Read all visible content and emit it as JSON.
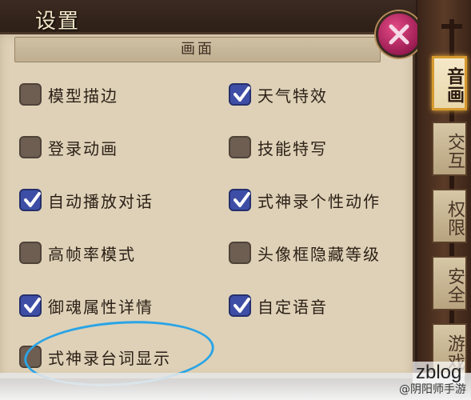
{
  "title": "设置",
  "close_icon": "close-x-icon",
  "section": {
    "header": "画面"
  },
  "options": [
    {
      "label": "模型描边",
      "checked": false
    },
    {
      "label": "天气特效",
      "checked": true
    },
    {
      "label": "登录动画",
      "checked": false
    },
    {
      "label": "技能特写",
      "checked": false
    },
    {
      "label": "自动播放对话",
      "checked": true
    },
    {
      "label": "式神录个性动作",
      "checked": true
    },
    {
      "label": "高帧率模式",
      "checked": false
    },
    {
      "label": "头像框隐藏等级",
      "checked": false
    },
    {
      "label": "御魂属性详情",
      "checked": true
    },
    {
      "label": "自定语音",
      "checked": true
    },
    {
      "label": "式神录台词显示",
      "checked": false
    }
  ],
  "tabs": [
    {
      "label": "音画",
      "active": true
    },
    {
      "label": "交互",
      "active": false
    },
    {
      "label": "权限",
      "active": false
    },
    {
      "label": "安全",
      "active": false
    },
    {
      "label": "游戏",
      "active": false
    }
  ],
  "watermark": "@阴阳师手游",
  "site_mark": "zblog",
  "colors": {
    "checkbox_on": "#3e4ea6",
    "checkbox_off": "#6e5e52",
    "active_tab_border": "#d69a2f",
    "annotation": "#2aa4e6"
  }
}
